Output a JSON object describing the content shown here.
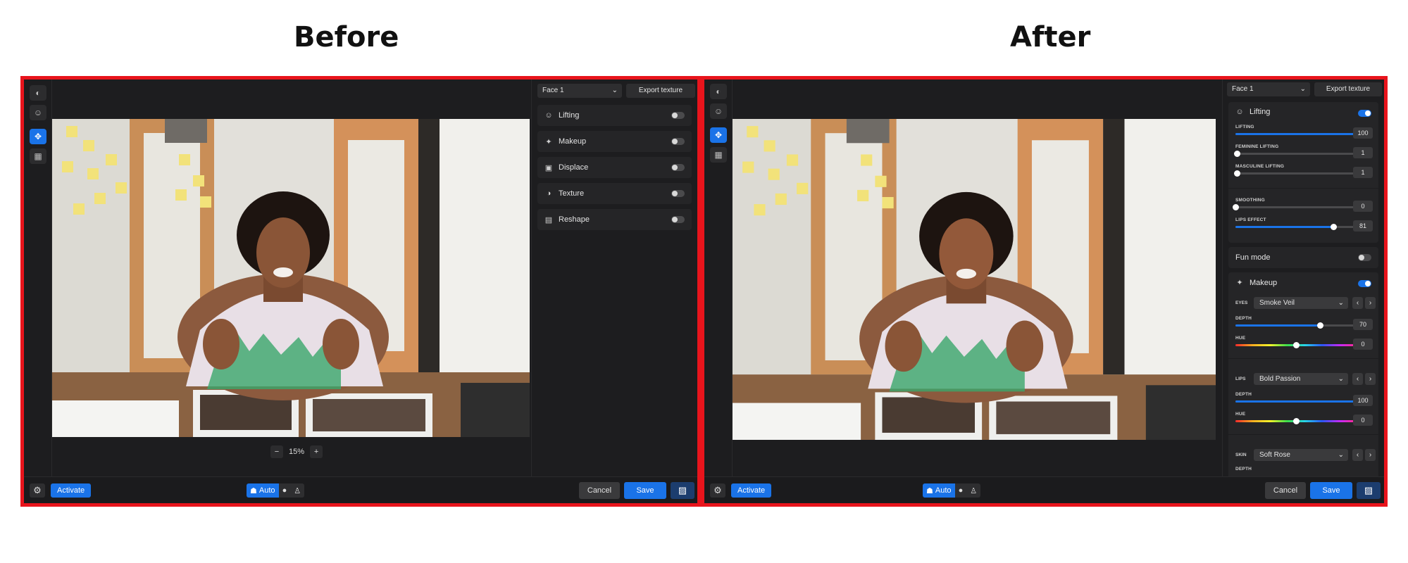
{
  "headings": {
    "before": "Before",
    "after": "After"
  },
  "colors": {
    "accent": "#1a73e8",
    "frame": "#e8141c",
    "panel_bg": "#1d1d1f"
  },
  "before": {
    "toolrail": [
      "mask-icon",
      "face-icon",
      "move-icon",
      "grid-icon"
    ],
    "zoom": {
      "level": "15%"
    },
    "panel": {
      "face_select": "Face 1",
      "export_label": "Export texture",
      "sections": [
        {
          "label": "Lifting",
          "icon": "lifting-icon",
          "enabled": false
        },
        {
          "label": "Makeup",
          "icon": "sparkle-icon",
          "enabled": false
        },
        {
          "label": "Displace",
          "icon": "displace-icon",
          "enabled": false
        },
        {
          "label": "Texture",
          "icon": "texture-icon",
          "enabled": false
        },
        {
          "label": "Reshape",
          "icon": "reshape-icon",
          "enabled": false
        }
      ]
    },
    "bottom": {
      "activate": "Activate",
      "mode_auto": "Auto",
      "cancel": "Cancel",
      "save": "Save"
    }
  },
  "after": {
    "panel": {
      "face_select": "Face 1",
      "export_label": "Export texture",
      "lifting": {
        "label": "Lifting",
        "enabled": true,
        "sliders": [
          {
            "label": "LIFTING",
            "value": "100",
            "fraction": 1.0
          },
          {
            "label": "FEMININE LIFTING",
            "value": "1",
            "fraction": 0.01
          },
          {
            "label": "MASCULINE LIFTING",
            "value": "1",
            "fraction": 0.01
          }
        ],
        "sliders2": [
          {
            "label": "SMOOTHING",
            "value": "0",
            "fraction": 0.0
          },
          {
            "label": "LIPS EFFECT",
            "value": "81",
            "fraction": 0.81
          }
        ]
      },
      "fun_mode": {
        "label": "Fun mode",
        "enabled": false
      },
      "makeup": {
        "label": "Makeup",
        "enabled": true,
        "groups": [
          {
            "label": "EYES",
            "selected": "Smoke Veil",
            "depth_label": "DEPTH",
            "depth": "70",
            "depth_fraction": 0.7,
            "hue_label": "HUE",
            "hue": "0",
            "hue_fraction": 0.5
          },
          {
            "label": "LIPS",
            "selected": "Bold Passion",
            "depth_label": "DEPTH",
            "depth": "100",
            "depth_fraction": 1.0,
            "hue_label": "HUE",
            "hue": "0",
            "hue_fraction": 0.5
          },
          {
            "label": "SKIN",
            "selected": "Soft Rose",
            "depth_label": "DEPTH"
          }
        ]
      }
    },
    "bottom": {
      "activate": "Activate",
      "mode_auto": "Auto",
      "cancel": "Cancel",
      "save": "Save"
    }
  }
}
